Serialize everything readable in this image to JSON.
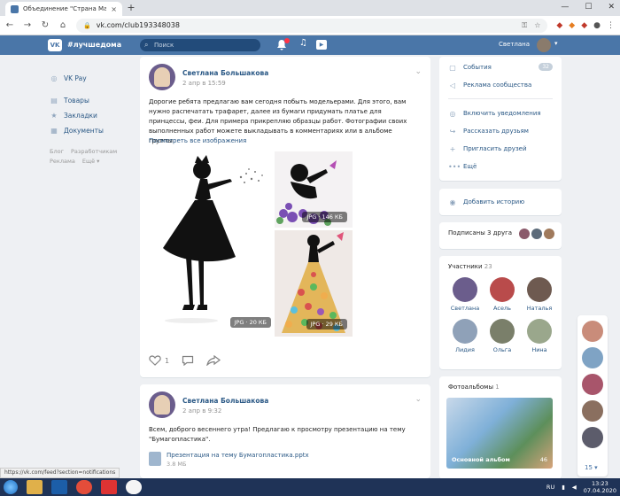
{
  "browser": {
    "tab_title": "Объединение \"Страна Мастер",
    "tab_close": "×",
    "new_tab": "+",
    "window_controls": [
      "—",
      "☐",
      "✕"
    ],
    "nav": {
      "back": "←",
      "forward": "→",
      "reload": "↻",
      "home": "⌂"
    },
    "url": "vk.com/club193348038",
    "lock": "🔒"
  },
  "vk": {
    "logo": "VK",
    "hashtag": "#лучшедома",
    "search_placeholder": "Поиск",
    "user_name": "Светлана",
    "chevron": "▾",
    "music_icon": "♫",
    "play_icon": "▶"
  },
  "left_menu": {
    "items": [
      {
        "label": "VK Pay",
        "icon": "vkpay-icon",
        "glyph": "◎"
      },
      {
        "label": "Товары",
        "icon": "bag-icon",
        "glyph": "▤"
      },
      {
        "label": "Закладки",
        "icon": "star-icon",
        "glyph": "★"
      },
      {
        "label": "Документы",
        "icon": "document-icon",
        "glyph": "▦"
      }
    ],
    "footer": [
      "Блог",
      "Разработчикам",
      "Реклама",
      "Ещё ▾"
    ]
  },
  "post1": {
    "author": "Светлана Большакова",
    "date": "2 апр в 15:59",
    "text": "Дорогие ребята предлагаю вам сегодня побыть модельерами. Для этого, вам нужно распечатать трафарет, далее из бумаги придумать платье для принцессы, феи. Для примера прикрепляю образцы работ. Фотографии своих выполненных работ можете выкладывать в комментариях или в альбоме группы.",
    "show_all": "Посмотреть все изображения",
    "images": [
      {
        "badge": "JPG · 20 КБ"
      },
      {
        "badge": "JPG · 146 КБ"
      },
      {
        "badge": "JPG · 29 КБ"
      }
    ],
    "likes": "1"
  },
  "post2": {
    "author": "Светлана Большакова",
    "date": "2 апр в 9:32",
    "text": "Всем, доброго весеннего утра! Предлагаю к просмотру презентацию на тему \"Бумагопластика\".",
    "doc_name": "Презентация на тему Бумагопластика.pptx",
    "doc_size": "3.8 МБ"
  },
  "right": {
    "menu": [
      {
        "label": "События",
        "count": "32",
        "glyph": "▢"
      },
      {
        "label": "Реклама сообщества",
        "count": "",
        "glyph": "◁"
      }
    ],
    "menu2": [
      {
        "label": "Включить уведомления",
        "glyph": "◎"
      },
      {
        "label": "Рассказать друзьям",
        "glyph": "↪"
      },
      {
        "label": "Пригласить друзей",
        "glyph": "+"
      },
      {
        "label": "Ещё",
        "glyph": "•••"
      }
    ],
    "story": {
      "label": "Добавить историю",
      "glyph": "◉"
    },
    "friends": {
      "label": "Подписаны 3 друга"
    },
    "members": {
      "title": "Участники",
      "count": "23",
      "people": [
        {
          "name": "Светлана",
          "color": "#6b5d8c"
        },
        {
          "name": "Асель",
          "color": "#b94b4b"
        },
        {
          "name": "Наталья",
          "color": "#6e5a50"
        },
        {
          "name": "Лидия",
          "color": "#8fa1b8"
        },
        {
          "name": "Ольга",
          "color": "#7a7f6a"
        },
        {
          "name": "Нина",
          "color": "#9aa78c"
        }
      ]
    },
    "albums": {
      "title": "Фотоальбомы",
      "count": "1",
      "album_name": "Основной альбом",
      "album_count": "46"
    }
  },
  "chat": {
    "count": "15 ▾",
    "colors": [
      "#c98c7a",
      "#7fa3c4",
      "#a8556b",
      "#8a6f5f",
      "#5c5c6b"
    ]
  },
  "status_url": "https://vk.com/feed?section=notifications",
  "taskbar": {
    "apps": [
      {
        "name": "explorer-icon",
        "color": "#e0b04a"
      },
      {
        "name": "media-icon",
        "color": "#1c5ea8"
      },
      {
        "name": "chrome-icon",
        "color": "#e44d3a"
      },
      {
        "name": "yandex-icon",
        "color": "#d33"
      },
      {
        "name": "yandex-browser-icon",
        "color": "#f5f5f5"
      }
    ],
    "lang": "RU",
    "time": "13:23",
    "date": "07.04.2020"
  },
  "colors": {
    "vk_blue": "#4a76a8",
    "link": "#2a5885",
    "bg": "#eef0f3"
  }
}
